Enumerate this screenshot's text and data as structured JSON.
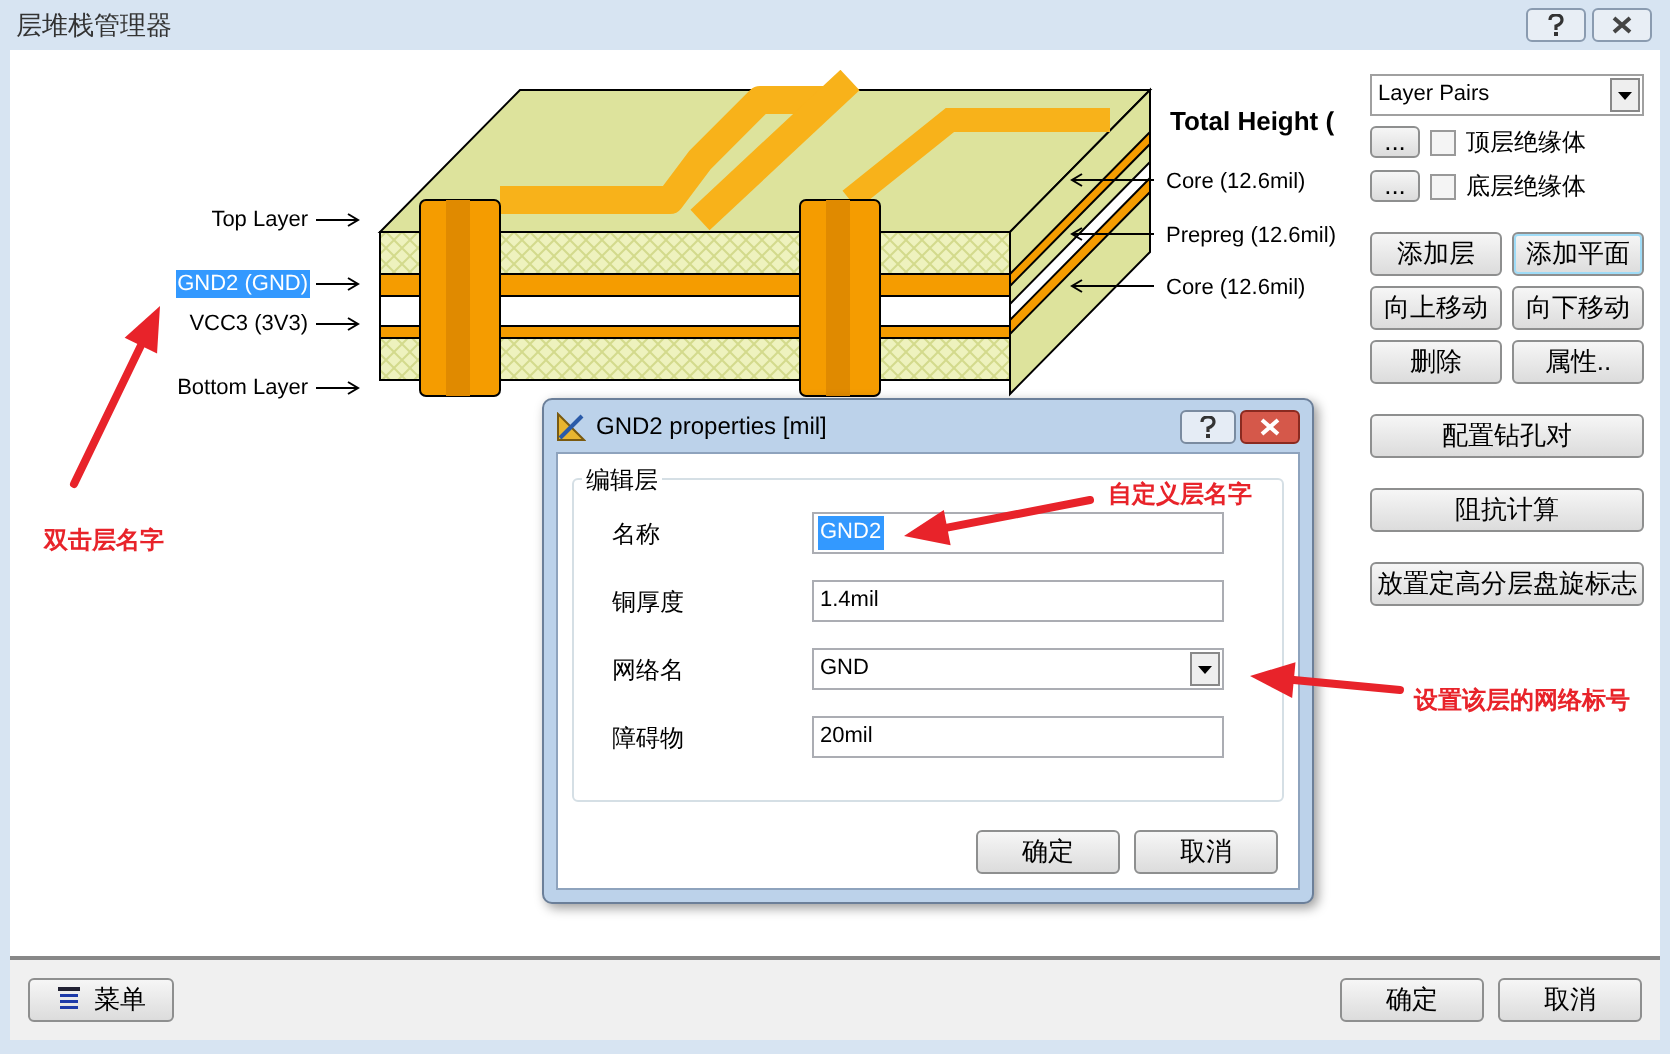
{
  "window": {
    "title": "层堆栈管理器"
  },
  "stack_diagram": {
    "layer_labels": [
      {
        "label": "Top Layer",
        "selected": false
      },
      {
        "label": "GND2 (GND)",
        "selected": true
      },
      {
        "label": "VCC3 (3V3)",
        "selected": false
      },
      {
        "label": "Bottom Layer",
        "selected": false
      }
    ],
    "total_height": "Total Height (",
    "dielectric_labels": [
      "Core (12.6mil)",
      "Prepreg (12.6mil)",
      "Core (12.6mil)"
    ]
  },
  "right_panel": {
    "dropdown": "Layer Pairs",
    "checkboxes": [
      {
        "button": "...",
        "label": "顶层绝缘体",
        "checked": false
      },
      {
        "button": "...",
        "label": "底层绝缘体",
        "checked": false
      }
    ],
    "buttons": [
      {
        "label": "添加层",
        "focused": false
      },
      {
        "label": "添加平面",
        "focused": true
      },
      {
        "label": "向上移动",
        "focused": false
      },
      {
        "label": "向下移动",
        "focused": false
      },
      {
        "label": "删除",
        "focused": false
      },
      {
        "label": "属性..",
        "focused": false
      }
    ],
    "wide_buttons": [
      "配置钻孔对",
      "阻抗计算",
      "放置定高分层盘旋标志"
    ]
  },
  "footer": {
    "menu_button": "菜单",
    "ok": "确定",
    "cancel": "取消"
  },
  "dialog": {
    "title": "GND2 properties [mil]",
    "group": "编辑层",
    "fields": [
      {
        "label": "名称",
        "value": "GND2",
        "kind": "text",
        "selected": true
      },
      {
        "label": "铜厚度",
        "value": "1.4mil",
        "kind": "text",
        "selected": false
      },
      {
        "label": "网络名",
        "value": "GND",
        "kind": "dropdown",
        "selected": false
      },
      {
        "label": "障碍物",
        "value": "20mil",
        "kind": "text",
        "selected": false
      }
    ],
    "ok": "确定",
    "cancel": "取消"
  },
  "annotations": [
    "双击层名字",
    "自定义层名字",
    "设置该层的网络标号"
  ]
}
